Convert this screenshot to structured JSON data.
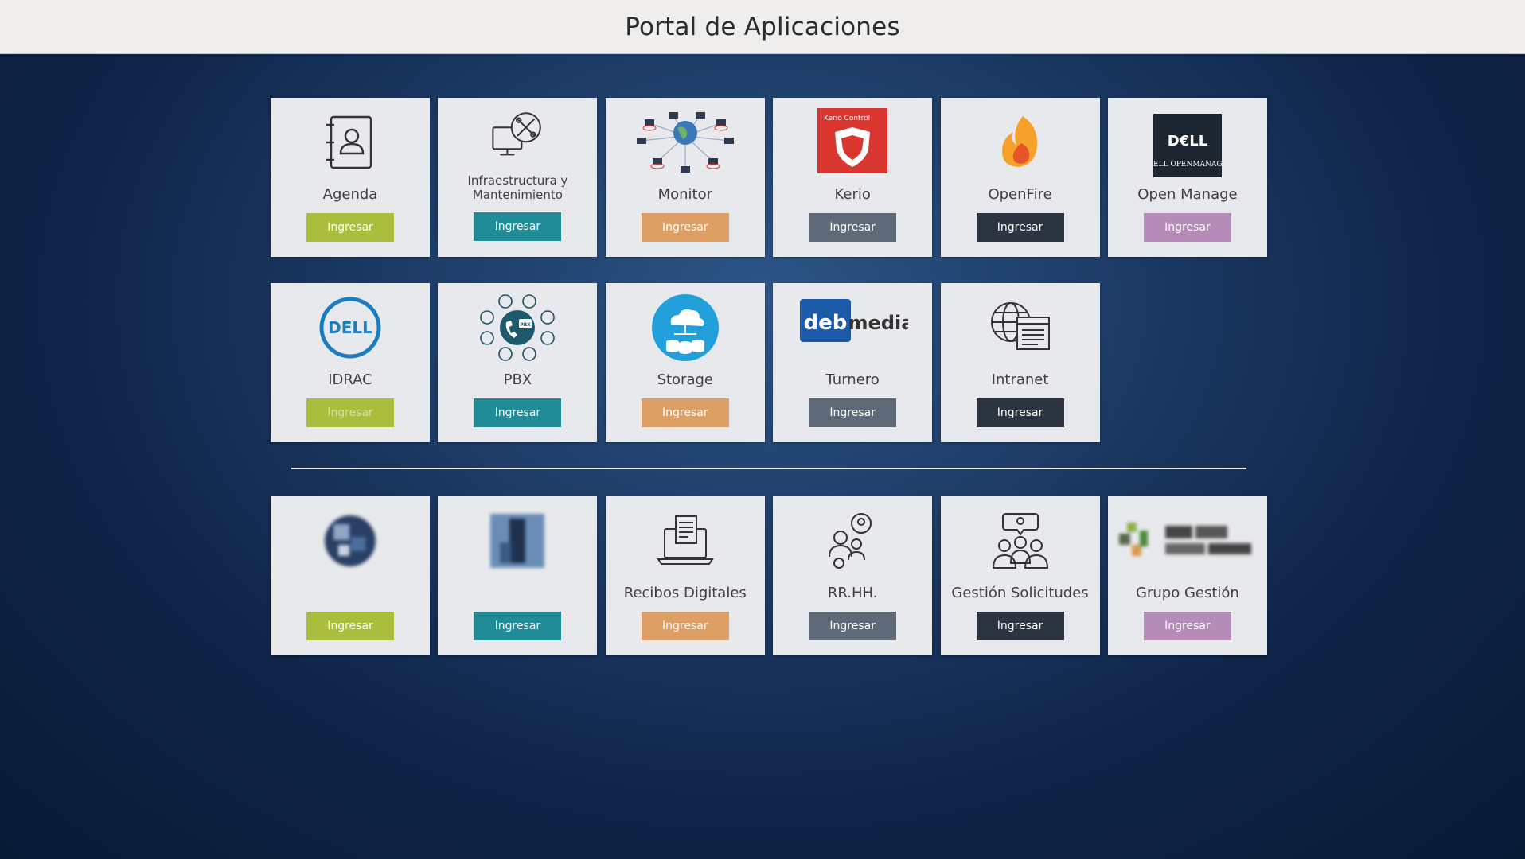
{
  "header": {
    "title": "Portal de Aplicaciones"
  },
  "colors": {
    "green": "#aabd3c",
    "teal": "#1f8c98",
    "orange": "#dd9f63",
    "slate": "#5e6977",
    "dark": "#2d3441",
    "purple": "#b58bb8",
    "card_bg": "#e8e9ec",
    "header_bg": "#efeeec"
  },
  "apps_row1": [
    {
      "name": "Agenda",
      "icon": "contact-book-icon",
      "button": "Ingresar"
    },
    {
      "name": "Infraestructura y Mantenimiento",
      "icon": "computer-tools-icon",
      "button": "Ingresar"
    },
    {
      "name": "Monitor",
      "icon": "network-globe-icon",
      "button": "Ingresar"
    },
    {
      "name": "Kerio",
      "icon": "kerio-control-logo-icon",
      "logo_text": "Kerio Control",
      "button": "Ingresar"
    },
    {
      "name": "OpenFire",
      "icon": "openfire-flame-icon",
      "button": "Ingresar"
    },
    {
      "name": "Open Manage",
      "icon": "dell-openmanage-logo-icon",
      "logo_text": "DELL OPENMANAGE",
      "button": "Ingresar"
    }
  ],
  "apps_row2": [
    {
      "name": "IDRAC",
      "icon": "dell-logo-icon",
      "logo_text": "DELL",
      "button": "Ingresar"
    },
    {
      "name": "PBX",
      "icon": "pbx-phones-icon",
      "logo_text": "PBX",
      "button": "Ingresar"
    },
    {
      "name": "Storage",
      "icon": "cloud-storage-icon",
      "button": "Ingresar"
    },
    {
      "name": "Turnero",
      "icon": "debmedia-logo-icon",
      "logo_text": "debmedia",
      "button": "Ingresar"
    },
    {
      "name": "Intranet",
      "icon": "globe-browser-icon",
      "button": "Ingresar"
    }
  ],
  "apps_row3": [
    {
      "name": "",
      "icon": "blurred-app-icon",
      "button": "Ingresar"
    },
    {
      "name": "",
      "icon": "blurred-app-icon",
      "button": "Ingresar"
    },
    {
      "name": "Recibos Digitales",
      "icon": "digital-receipt-icon",
      "button": "Ingresar"
    },
    {
      "name": "RR.HH.",
      "icon": "people-chat-icon",
      "button": "Ingresar"
    },
    {
      "name": "Gestión Solicitudes",
      "icon": "team-idea-icon",
      "button": "Ingresar"
    },
    {
      "name": "Grupo Gestión",
      "icon": "blurred-logo-icon",
      "button": "Ingresar"
    }
  ]
}
